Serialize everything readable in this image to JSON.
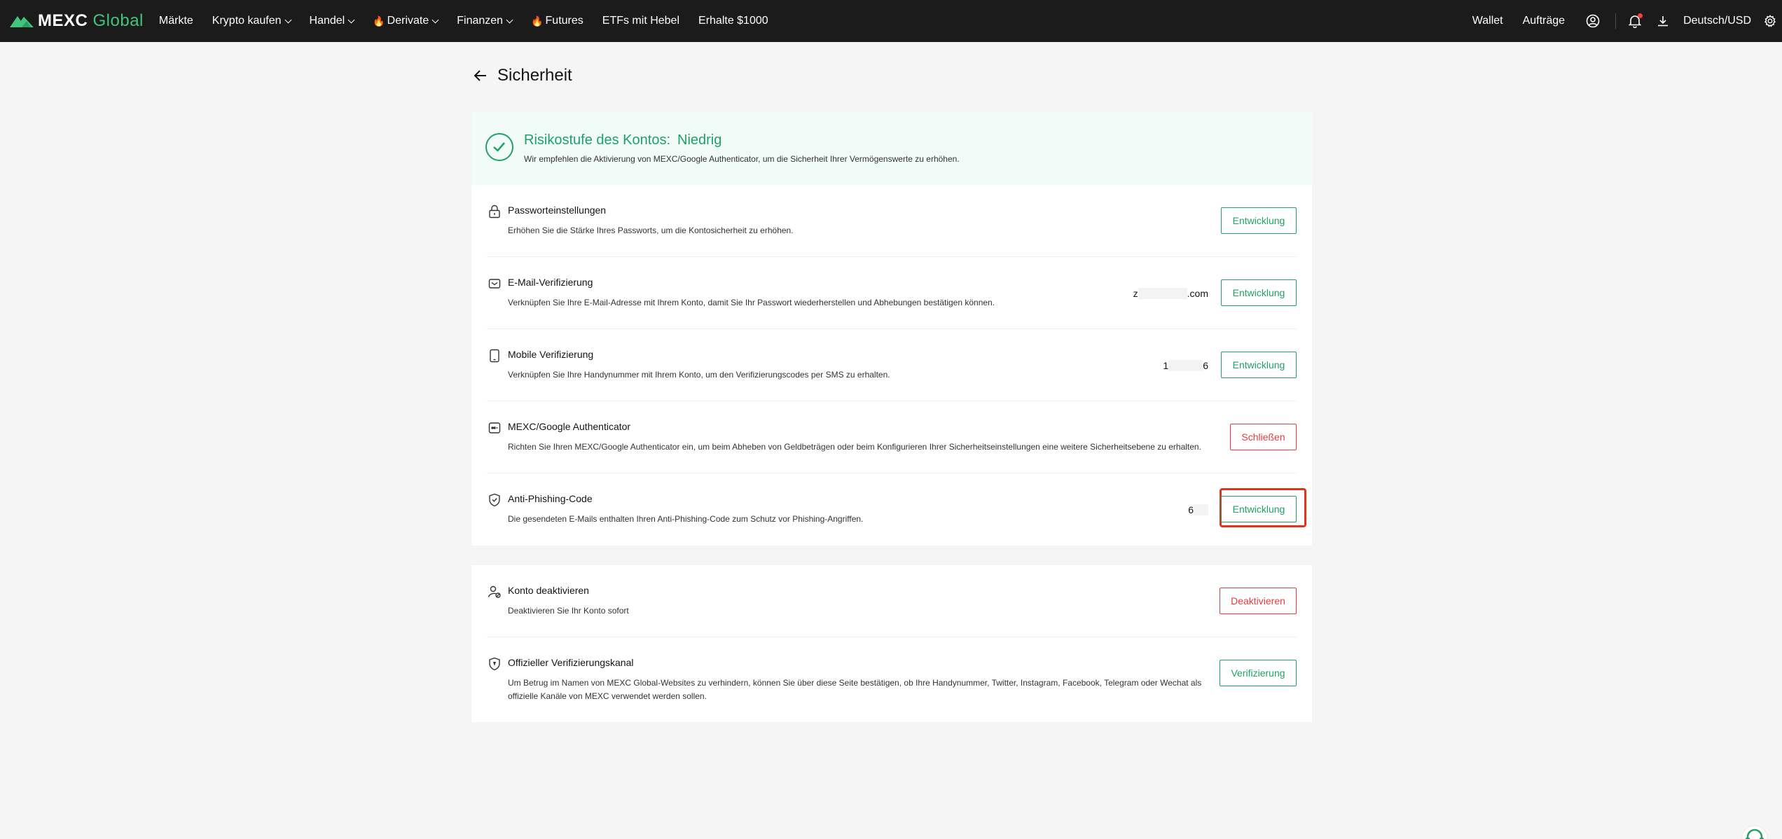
{
  "nav": {
    "logo_main": "MEXC",
    "logo_accent": "Global",
    "items": [
      {
        "label": "Märkte",
        "dropdown": false,
        "hot": false
      },
      {
        "label": "Krypto kaufen",
        "dropdown": true,
        "hot": false
      },
      {
        "label": "Handel",
        "dropdown": true,
        "hot": false
      },
      {
        "label": "Derivate",
        "dropdown": true,
        "hot": true
      },
      {
        "label": "Finanzen",
        "dropdown": true,
        "hot": false
      },
      {
        "label": "Futures",
        "dropdown": false,
        "hot": true
      },
      {
        "label": "ETFs mit Hebel",
        "dropdown": false,
        "hot": false
      },
      {
        "label": "Erhalte $1000",
        "dropdown": false,
        "hot": false
      }
    ],
    "right": {
      "wallet": "Wallet",
      "orders": "Aufträge",
      "language": "Deutsch/USD",
      "icons": [
        "user-circle-icon",
        "bell-icon",
        "download-icon",
        "gear-icon"
      ]
    }
  },
  "page": {
    "title": "Sicherheit"
  },
  "banner": {
    "title_prefix": "Risikostufe des Kontos:",
    "level": "Niedrig",
    "subtitle": "Wir empfehlen die Aktivierung von MEXC/Google Authenticator, um die Sicherheit Ihrer Vermögenswerte zu erhöhen."
  },
  "security_items": [
    {
      "icon": "lock-icon",
      "title": "Passworteinstellungen",
      "desc": "Erhöhen Sie die Stärke Ihres Passworts, um die Kontosicherheit zu erhöhen.",
      "value_visible": "",
      "button": "Entwicklung",
      "button_style": "green"
    },
    {
      "icon": "mail-icon",
      "title": "E-Mail-Verifizierung",
      "desc": "Verknüpfen Sie Ihre E-Mail-Adresse mit Ihrem Konto, damit Sie Ihr Passwort wiederherstellen und Abhebungen bestätigen können.",
      "value_start": "z",
      "value_end": ".com",
      "button": "Entwicklung",
      "button_style": "green"
    },
    {
      "icon": "phone-icon",
      "title": "Mobile Verifizierung",
      "desc": "Verknüpfen Sie Ihre Handynummer mit Ihrem Konto, um den Verifizierungscodes per SMS zu erhalten.",
      "value_start": "1",
      "value_end": "6",
      "button": "Entwicklung",
      "button_style": "green"
    },
    {
      "icon": "authenticator-icon",
      "title": "MEXC/Google Authenticator",
      "desc": "Richten Sie Ihren MEXC/Google Authenticator ein, um beim Abheben von Geldbeträgen oder beim Konfigurieren Ihrer Sicherheitseinstellungen eine weitere Sicherheitsebene zu erhalten.",
      "value_visible": "",
      "button": "Schließen",
      "button_style": "red"
    },
    {
      "icon": "shield-check-icon",
      "title": "Anti-Phishing-Code",
      "desc": "Die gesendeten E-Mails enthalten Ihren Anti-Phishing-Code zum Schutz vor Phishing-Angriffen.",
      "value_start": "6",
      "value_end": "",
      "button": "Entwicklung",
      "button_style": "green",
      "highlighted": true
    }
  ],
  "account_items": [
    {
      "icon": "user-deactivate-icon",
      "title": "Konto deaktivieren",
      "desc": "Deaktivieren Sie Ihr Konto sofort",
      "button": "Deaktivieren",
      "button_style": "red"
    },
    {
      "icon": "badge-shield-icon",
      "title": "Offizieller Verifizierungskanal",
      "desc_line1": "Um Betrug im Namen von MEXC Global-Websites zu verhindern, können Sie über diese Seite bestätigen, ob Ihre Handynummer, Twitter, Instagram, Facebook, Telegram oder Wechat als",
      "desc_line2": "offizielle Kanäle von MEXC verwendet werden sollen.",
      "button": "Verifizierung",
      "button_style": "green"
    }
  ],
  "colors": {
    "brand_green": "#21a067",
    "danger_red": "#e73c3c",
    "nav_bg": "#1b1b1b",
    "page_bg": "#f5f5f5",
    "highlight": "#e0351c"
  }
}
